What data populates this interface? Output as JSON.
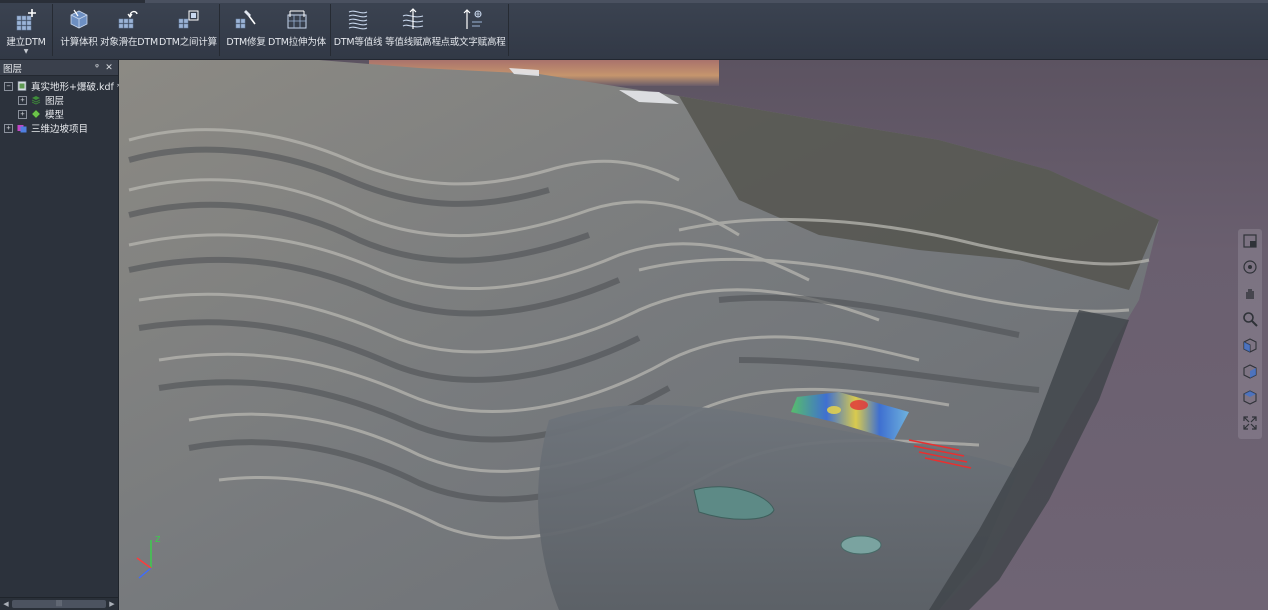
{
  "ribbon": {
    "buttons": [
      {
        "id": "build-dtm",
        "label": "建立DTM",
        "has_dropdown": true,
        "icon": "dtm-grid-plus-icon"
      },
      {
        "id": "calc-volume",
        "label": "计算体积",
        "icon": "volume-cube-icon"
      },
      {
        "id": "drape-dtm",
        "label": "对象滑在DTM",
        "icon": "drape-object-icon"
      },
      {
        "id": "between-dtm",
        "label": "DTM之间计算",
        "icon": "dtm-compare-icon"
      },
      {
        "id": "dtm-repair",
        "label": "DTM修复",
        "icon": "dtm-repair-hammer-icon"
      },
      {
        "id": "dtm-extrude",
        "label": "DTM拉伸为体",
        "icon": "dtm-extrude-icon"
      },
      {
        "id": "dtm-contour",
        "label": "DTM等值线",
        "icon": "contour-lines-icon"
      },
      {
        "id": "contour-elev",
        "label": "等值线赋高程",
        "icon": "contour-elevation-icon"
      },
      {
        "id": "point-text-elev",
        "label": "点或文字赋高程",
        "icon": "point-text-elevation-icon"
      }
    ]
  },
  "layers_panel": {
    "title": "图层",
    "pin_glyph": "ᵠ",
    "close_glyph": "✕",
    "tree": [
      {
        "label": "真实地形+爆破.kdf *",
        "expander": "−",
        "icon": "document-icon",
        "level": 0
      },
      {
        "label": "图层",
        "expander": "+",
        "icon": "layer-icon",
        "level": 1
      },
      {
        "label": "模型",
        "expander": "+",
        "icon": "model-icon",
        "level": 1
      },
      {
        "label": "三维边坡项目",
        "expander": "+",
        "icon": "project-icon",
        "level": 0
      }
    ],
    "scroll_glyphs": {
      "left": "◀",
      "right": "▶",
      "grip": "|||"
    }
  },
  "viewport": {
    "navigation": [
      "zoom-window-icon",
      "orbit-icon",
      "pan-hand-icon",
      "zoom-magnifier-icon",
      "view-cube-front-icon",
      "view-cube-side-icon",
      "view-cube-top-icon",
      "zoom-extents-icon"
    ],
    "axis_labels": {
      "x": "X",
      "y": "Y",
      "z": "Z"
    },
    "colors": {
      "sky_top": "#5c5361",
      "terrain": "#7d7c78",
      "heatmap_blue": "#3a6fd8",
      "heatmap_green": "#55c46a",
      "heatmap_red": "#e23a3a",
      "blast_lines": "#e83030"
    }
  }
}
